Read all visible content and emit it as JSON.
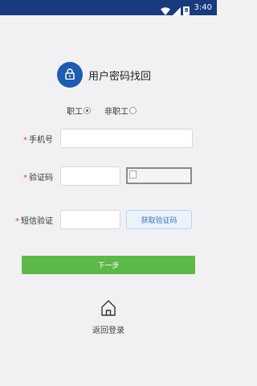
{
  "status_bar": {
    "time": "3:40",
    "battery_level": "8"
  },
  "header": {
    "title": "用户密码找回"
  },
  "user_type": {
    "options": [
      {
        "label": "职工",
        "selected": true
      },
      {
        "label": "非职工",
        "selected": false
      }
    ]
  },
  "form": {
    "phone_label": "手机号",
    "captcha_label": "验证码",
    "sms_label": "短信验证",
    "required_mark": "*",
    "phone_value": "",
    "captcha_value": "",
    "sms_value": "",
    "get_code_button": "获取验证码"
  },
  "next_button": "下一步",
  "back_login": "返回登录",
  "colors": {
    "status_bar": "#1a3a7e",
    "accent_blue": "#1f5cb0",
    "next_green": "#5cb947",
    "required_red": "#e23b3b"
  }
}
